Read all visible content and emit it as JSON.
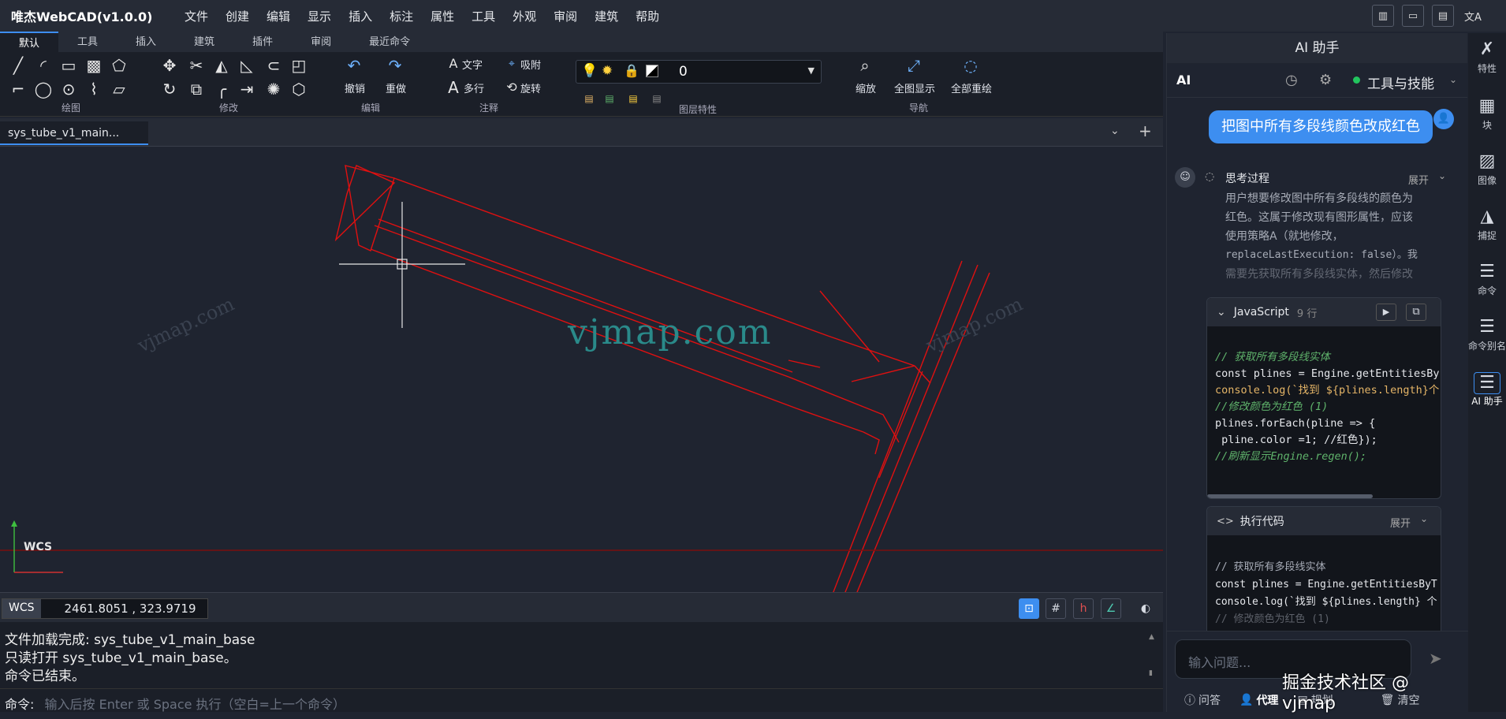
{
  "app": {
    "title": "唯杰WebCAD(v1.0.0)"
  },
  "menu": [
    "文件",
    "创建",
    "编辑",
    "显示",
    "插入",
    "标注",
    "属性",
    "工具",
    "外观",
    "审阅",
    "建筑",
    "帮助"
  ],
  "ribbon_tabs": [
    "默认",
    "工具",
    "插入",
    "建筑",
    "插件",
    "审阅",
    "最近命令"
  ],
  "ribbon": {
    "groups": {
      "draw": "绘图",
      "modify": "修改",
      "edit": "编辑",
      "annotate": "注释",
      "layer": "图层特性",
      "nav": "导航"
    },
    "undo": "撤销",
    "redo": "重做",
    "text": "文字",
    "mtext": "多行",
    "snap": "吸附",
    "rotate": "旋转",
    "layer_value": "0",
    "zoom": "缩放",
    "fit": "全图显示",
    "regen": "全部重绘"
  },
  "file_tab": "sys_tube_v1_main...",
  "canvas": {
    "watermark": "vjmap.com",
    "watermark_small": "vjmap.com",
    "ucs": "WCS"
  },
  "status": {
    "mode": "WCS",
    "coords": "2461.8051 , 323.9719"
  },
  "console": {
    "lines": [
      "文件加载完成: sys_tube_v1_main_base",
      "只读打开 sys_tube_v1_main_base。",
      "命令已结束。"
    ]
  },
  "cmd": {
    "label": "命令:",
    "placeholder": "输入后按 Enter 或 Space 执行（空白=上一个命令）"
  },
  "ai": {
    "panel_title": "AI 助手",
    "label": "AI",
    "mode": "工具与技能",
    "user_message": "把图中所有多段线颜色改成红色",
    "thinking_title": "思考过程",
    "expand": "展开",
    "thinking_text": [
      "用户想要修改图中所有多段线的颜色为",
      "红色。这属于修改现有图形属性，应该",
      "使用策略A（就地修改，",
      "replaceLastExecution: false）。我",
      "需要先获取所有多段线实体，然后修改"
    ],
    "code_lang": "JavaScript",
    "code_lines": "9 行",
    "code": [
      "// 获取所有多段线实体",
      "const plines = Engine.getEntitiesBy",
      "console.log(`找到 ${plines.length}个",
      "",
      "//修改颜色为红色 (1)",
      "plines.forEach(pline => {",
      " pline.color =1; //红色});",
      "",
      "//刷新显示Engine.regen();"
    ],
    "exec_title": "执行代码",
    "exec_code": [
      "// 获取所有多段线实体",
      "const plines = Engine.getEntitiesByT",
      "console.log(`找到 ${plines.length} 个",
      "",
      "// 修改颜色为红色 (1)"
    ],
    "input_placeholder": "输入问题...",
    "footer_tabs": [
      "问答",
      "代理",
      "规划",
      "清空"
    ],
    "brand": "掘金技术社区 @ vjmap"
  },
  "rightbar": [
    "特性",
    "块",
    "图像",
    "捕捉",
    "命令",
    "命令别名",
    "AI 助手"
  ],
  "colors": {
    "accent": "#3d8ef0",
    "entity": "#e01010",
    "watermark": "#2a8a8a"
  }
}
